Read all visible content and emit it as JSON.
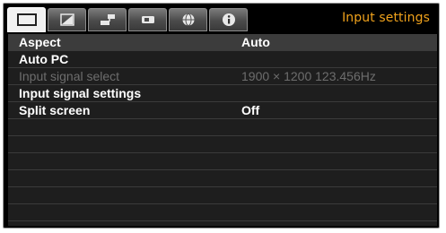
{
  "header": {
    "title": "Input settings",
    "accent_color": "#f0a21c",
    "tabs": [
      {
        "icon": "screen-icon",
        "active": true
      },
      {
        "icon": "picture-adjust-icon",
        "active": false
      },
      {
        "icon": "install-settings-icon",
        "active": false
      },
      {
        "icon": "system-settings-icon",
        "active": false
      },
      {
        "icon": "network-icon",
        "active": false
      },
      {
        "icon": "info-icon",
        "active": false
      }
    ]
  },
  "menu": {
    "items": [
      {
        "label": "Aspect",
        "value": "Auto",
        "enabled": true
      },
      {
        "label": "Auto PC",
        "value": "",
        "enabled": true
      },
      {
        "label": "Input signal select",
        "value": "1900 × 1200 123.456Hz",
        "enabled": false
      },
      {
        "label": "Input signal settings",
        "value": "",
        "enabled": true
      },
      {
        "label": "Split screen",
        "value": "Off",
        "enabled": true
      }
    ]
  }
}
